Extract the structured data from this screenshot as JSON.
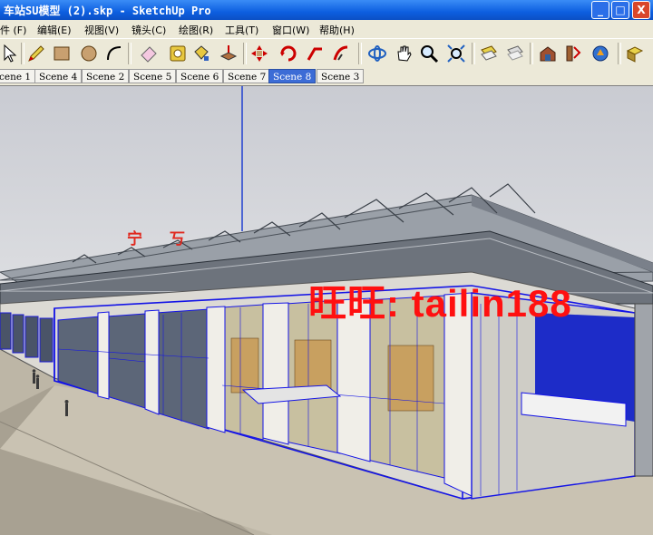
{
  "window": {
    "title": "车站SU模型 (2).skp - SketchUp Pro",
    "minimize": "_",
    "maximize": "□",
    "close": "X"
  },
  "menu": [
    "件 (F)",
    "编辑(E)",
    "视图(V)",
    "镜头(C)",
    "绘图(R)",
    "工具(T)",
    "窗口(W)",
    "帮助(H)"
  ],
  "toolbar": {
    "icons": [
      "select-icon",
      "pencil-icon",
      "rectangle-icon",
      "circle-icon",
      "arc-icon",
      "eraser-icon",
      "tape-measure-icon",
      "paint-bucket-icon",
      "push-pull-icon",
      "move-icon",
      "rotate-icon",
      "follow-me-icon",
      "orbit-icon",
      "pan-icon",
      "zoom-icon",
      "zoom-extents-icon",
      "previous-view-icon",
      "next-view-icon",
      "warehouse-icon",
      "components-icon",
      "share-model-icon",
      "extension-icon"
    ]
  },
  "scenes": {
    "tabs": [
      "cene 1",
      "Scene 4",
      "Scene 2",
      "Scene 5",
      "Scene 6",
      "Scene 7",
      "Scene 8",
      "Scene 3"
    ],
    "active": "Scene 8"
  },
  "viewport": {
    "sign_text": "宁 丂",
    "watermark": "旺旺: tailin188"
  },
  "colors": {
    "titlebar": "#0d5fe0",
    "selection_blue": "#1010e0",
    "active_tab": "#3c6cd6",
    "watermark": "#ff1010"
  }
}
